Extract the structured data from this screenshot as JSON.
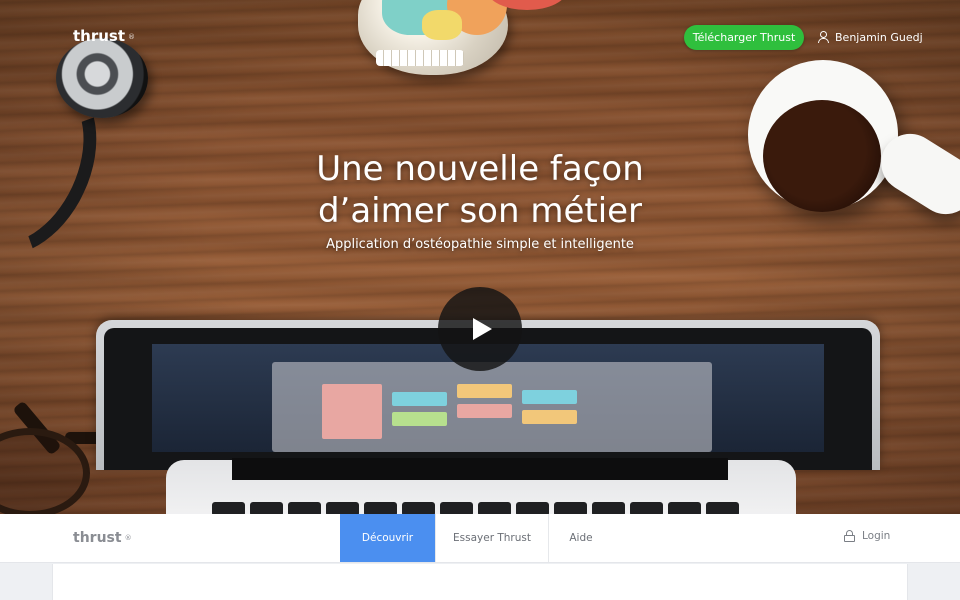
{
  "header": {
    "logo_text": "thrust",
    "logo_mark": "®",
    "download_label": "Télécharger Thrust",
    "user_name": "Benjamin Guedj",
    "user_icon": "user-icon"
  },
  "hero": {
    "headline_line1": "Une nouvelle façon",
    "headline_line2": "d’aimer son métier",
    "subtitle": "Application d’ostéopathie simple et intelligente",
    "play_icon": "play-icon"
  },
  "subnav": {
    "logo_text": "thrust",
    "logo_mark": "®",
    "tabs": [
      {
        "label": "Découvrir",
        "active": true
      },
      {
        "label": "Essayer Thrust",
        "active": false
      },
      {
        "label": "Aide",
        "active": false
      }
    ],
    "login_label": "Login",
    "login_icon": "lock-icon"
  },
  "colors": {
    "accent_green": "#2fbf3d",
    "active_tab_blue": "#4b8ff0",
    "nav_text": "#6b6f76"
  }
}
